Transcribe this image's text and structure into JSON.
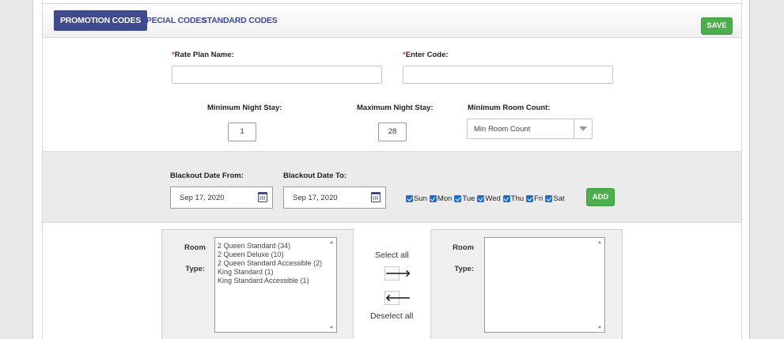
{
  "tabs": [
    {
      "label": "PROMOTION CODES"
    },
    {
      "label": "SPECIAL CODES"
    },
    {
      "label": "STANDARD CODES"
    }
  ],
  "save_label": "SAVE",
  "form": {
    "rate_plan_required_mark": "*",
    "rate_plan_label": "Rate Plan Name:",
    "rate_plan_value": "",
    "enter_code_required_mark": "*",
    "enter_code_label": "Enter Code:",
    "enter_code_value": "",
    "min_night_label": "Minimum Night Stay:",
    "min_night_value": "1",
    "max_night_label": "Maximum Night Stay:",
    "max_night_value": "28",
    "min_room_label": "Minimum Room Count:",
    "min_room_selected": "Min Room Count"
  },
  "blackout": {
    "from_label": "Blackout Date From:",
    "from_value": "Sep 17, 2020",
    "to_label": "Blackout Date To:",
    "to_value": "Sep 17, 2020",
    "days": [
      {
        "label": "Sun",
        "checked": true
      },
      {
        "label": "Mon",
        "checked": true
      },
      {
        "label": "Tue",
        "checked": true
      },
      {
        "label": "Wed",
        "checked": true
      },
      {
        "label": "Thu",
        "checked": true
      },
      {
        "label": "Fri",
        "checked": true
      },
      {
        "label": "Sat",
        "checked": true
      }
    ],
    "add_label": "ADD"
  },
  "rooms": {
    "room_label": "Room",
    "type_label": "Type:",
    "available": [
      "2 Queen Standard (34)",
      "2 Queen Deluxe (10)",
      "2 Queen Standard Accessible (2)",
      "King Standard (1)",
      "King Standard Accessible (1)"
    ],
    "select_all_label": "Select all",
    "deselect_all_label": "Deselect all",
    "move_right_glyph": "🡒",
    "move_left_glyph": "🡐",
    "selected": []
  },
  "colors": {
    "active_tab": "#3f4a8f",
    "tab_text": "#3d4a9a",
    "action_green": "#4cae4c",
    "required": "#e0452f",
    "checkbox": "#1a6fd6"
  }
}
